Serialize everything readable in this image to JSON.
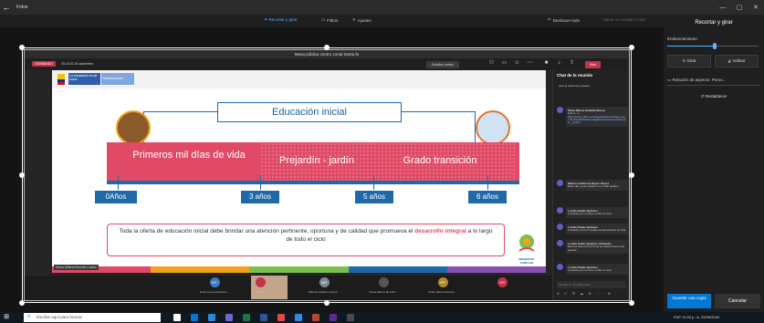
{
  "app": {
    "title": "Fotos",
    "back_icon": "back-arrow-icon",
    "window_controls": [
      "—",
      "▢",
      "✕"
    ]
  },
  "toolbar": {
    "crop_label": "Recortar y girar",
    "filters_label": "Filtros",
    "adjust_label": "Ajustes",
    "undo_all_label": "Deshacer todo",
    "view_original_label": "Hacer un mosaico todo"
  },
  "teams": {
    "title": "Mesa pública centro zonal Santa fe",
    "rec_label": "GRABANDO",
    "meeting_time": "00:19:20   34 asistentes",
    "request_control": "Solicitar control",
    "leave_label": "Salir"
  },
  "slide": {
    "tag1": "La educación es de todos",
    "tag2": "Mineducación",
    "heading": "Educación inicial",
    "stage1": "Primeros mil días de vida",
    "stage2": "Prejardín - jardín",
    "stage3": "Grado transición",
    "ages": [
      "0Años",
      "3 años",
      "5 años",
      "6 años"
    ],
    "bottom_text_pre": "Toda la oferta de educación inicial debe brindar una atención pertinente, oportuna y de calidad que promueva el ",
    "bottom_text_bold": "desarrollo integral",
    "bottom_text_post": " a lo largo de todo el ciclo",
    "logo_text": "BIENESTAR FAMILIAR",
    "bottom_colors": [
      "#e04a66",
      "#f2a11f",
      "#7cc04b",
      "#1e6aa8",
      "#8a4fb3"
    ]
  },
  "presenter_label": "Diana Milena Morcillo Castro",
  "participants": [
    {
      "initials": "EC",
      "name": "Erika Lorena Ramírez...",
      "color": "#3b7bbf"
    },
    {
      "initials": "",
      "name": "GRABANDO",
      "color": "#c4314b"
    },
    {
      "initials": "MR",
      "name": "Markus Guillermo Reys...",
      "color": "#7b8794"
    },
    {
      "initials": "",
      "name": "Diana Milena Morcillo...",
      "color": "#555555"
    },
    {
      "initials": "PP",
      "name": "Pedro Alberto Ramos ...",
      "color": "#b58a2b"
    },
    {
      "initials": "OR",
      "name": "",
      "color": "#c4314b"
    }
  ],
  "chat": {
    "title": "Chat de la reunión",
    "messages": [
      {
        "name": "",
        "text": "para la asistencia gracias"
      },
      {
        "name": "Diana Milena Saldaña Rivera",
        "text": "9:41 a. m.",
        "link": "https://forms.office.com/Pages/ResponsePage.aspx?id=DQSIkWdsW0yxEjajBLZtrQAAAAAAAAAAAAN__pcAAA"
      },
      {
        "name": "Markus Guillermo Reyes Rivera",
        "text": "Buen día, ya se publicó en el chat público"
      },
      {
        "name": "Lorella Ovallo Quintero",
        "text": "(Invitado) ya me tiene recibo el chat"
      },
      {
        "name": "Lorella Ovallo Quintero",
        "text": "(Invitado) ya fue enviado temporalmente al chat"
      },
      {
        "name": "Lorella Ovallo Quintero (Invitado)",
        "text": "Buenos días para la firma de asistencia es ese gracias"
      },
      {
        "name": "Lorella Ovallo Quintero",
        "text": "(Invitado) ya me tiene recibo el chat"
      }
    ],
    "input_placeholder": "Escribe un mensaje nuevo",
    "tools": "A  ☺  ⊡  ☁  ⊕  ···  ➤"
  },
  "right_panel": {
    "title": "Recortar y girar",
    "straighten_label": "Enderezamiento",
    "straighten_value": 0.5,
    "rotate_label": "Girar",
    "flip_label": "Voltear",
    "aspect_label": "Relación de aspecto: Perso...",
    "reset_label": "Restablecer",
    "save_label": "Guardar una copia",
    "cancel_label": "Cancelar"
  },
  "taskbar": {
    "search_placeholder": "Escribe aquí para buscar",
    "tray": "ESP  12:00 p. m.  25/09/2020",
    "app_colors": [
      "#ffffff",
      "#0078d4",
      "#2b88d8",
      "#6b69d6",
      "#217346",
      "#2b579a",
      "#e8473c",
      "#2d89ef",
      "#b7472a",
      "#5c2d91",
      "#4a4a4a"
    ]
  }
}
